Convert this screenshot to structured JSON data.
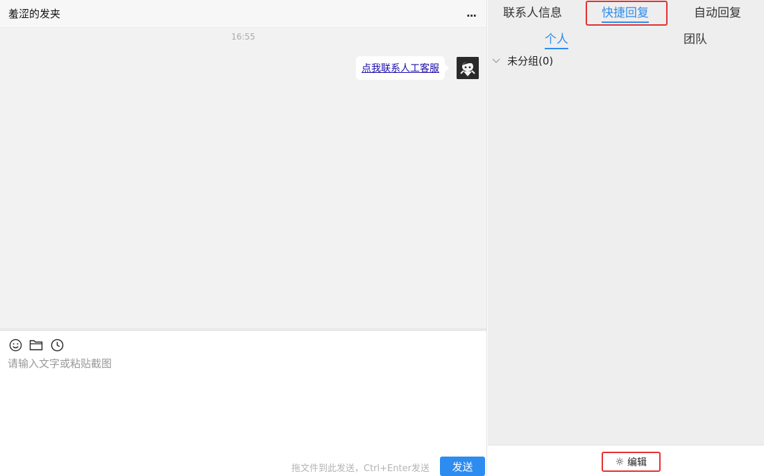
{
  "chat": {
    "title": "羞涩的发夹",
    "more_label": "...",
    "timestamp": "16:55",
    "message": "点我联系人工客服",
    "input_placeholder": "请输入文字或粘贴截图",
    "send_hint": "拖文件到此发送，Ctrl+Enter发送",
    "send_label": "发送",
    "toolbar_icons": [
      "smile-icon",
      "folder-icon",
      "clock-icon"
    ]
  },
  "right_panel": {
    "tabs": [
      {
        "label": "联系人信息",
        "active": false
      },
      {
        "label": "快捷回复",
        "active": true
      },
      {
        "label": "自动回复",
        "active": false
      }
    ],
    "sub_tabs": [
      {
        "label": "个人",
        "active": true
      },
      {
        "label": "团队",
        "active": false
      }
    ],
    "group": {
      "label": "未分组(0)",
      "expanded": true
    },
    "edit_label": "编辑"
  },
  "colors": {
    "accent": "#2d8cf0",
    "highlight_box": "#e33030",
    "link": "#1a0dab",
    "chat_bg": "#f2f2f2",
    "panel_bg": "#eeeeee"
  }
}
